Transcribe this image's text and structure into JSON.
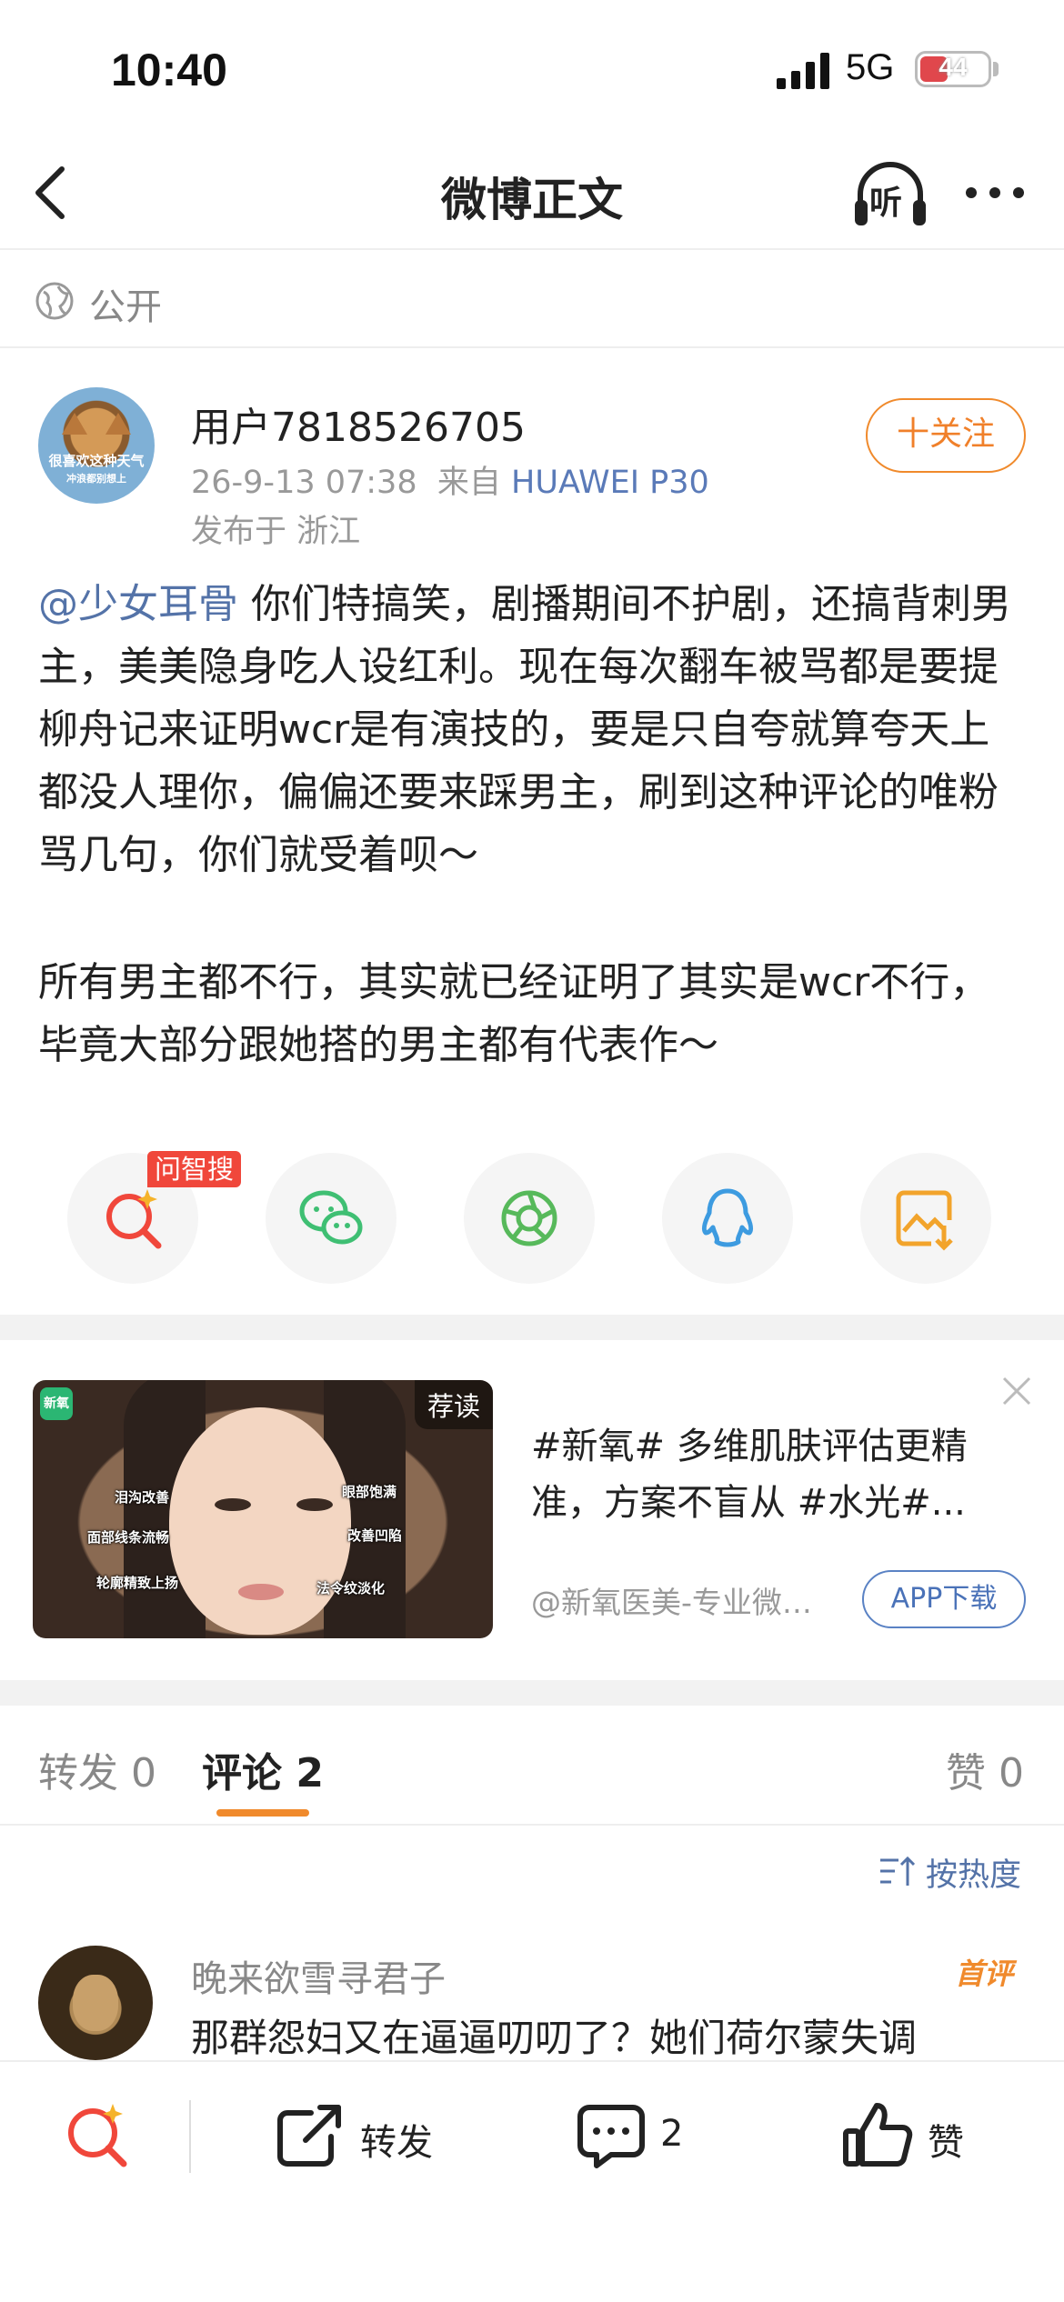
{
  "status_bar": {
    "time": "10:40",
    "network": "5G",
    "battery": "44"
  },
  "nav": {
    "title": "微博正文",
    "listen_label": "听"
  },
  "visibility": {
    "label": "公开"
  },
  "author": {
    "avatar_caption_1": "很喜欢这种天气",
    "avatar_caption_2": "冲浪都别想上",
    "username": "用户7818526705",
    "time": "26-9-13 07:38",
    "source_prefix": "来自",
    "device": "HUAWEI P30",
    "location": "发布于 浙江",
    "follow_label": "十关注"
  },
  "post": {
    "mention": "@少女耳骨",
    "text_1": " 你们特搞笑，剧播期间不护剧，还搞背刺男主，美美隐身吃人设红利。现在每次翻车被骂都是要提柳舟记来证明wcr是有演技的，要是只自夸就算夸天上都没人理你，偏偏还要来踩男主，刷到这种评论的唯粉骂几句，你们就受着呗～",
    "text_2": "所有男主都不行，其实就已经证明了其实是wcr不行，毕竟大部分跟她搭的男主都有代表作～"
  },
  "share": {
    "ai_badge": "问智搜"
  },
  "ad": {
    "logo": "新氧",
    "recommend_label": "荐读",
    "tags": [
      "泪沟改善",
      "眼部饱满",
      "面部线条流畅",
      "改善凹陷",
      "轮廓精致上扬",
      "法令纹淡化"
    ],
    "title": "#新氧# 多维肌肤评估更精准，方案不盲从 #水光#...",
    "source": "@新氧医美-专业微整形平台",
    "download_label": "APP下载"
  },
  "tabs": {
    "repost": "转发 0",
    "comments": "评论 2",
    "likes": "赞 0"
  },
  "sort": {
    "label": "按热度"
  },
  "comment": {
    "name": "晚来欲雪寻君子",
    "badge": "首评",
    "text": "那群怨妇又在逼逼叨叨了？她们荷尔蒙失调"
  },
  "toolbar": {
    "repost_label": "转发",
    "comment_count": "2",
    "like_label": "赞"
  },
  "colors": {
    "accent": "#f08a2c",
    "link": "#5473a8",
    "badge_red": "#f0473b"
  }
}
